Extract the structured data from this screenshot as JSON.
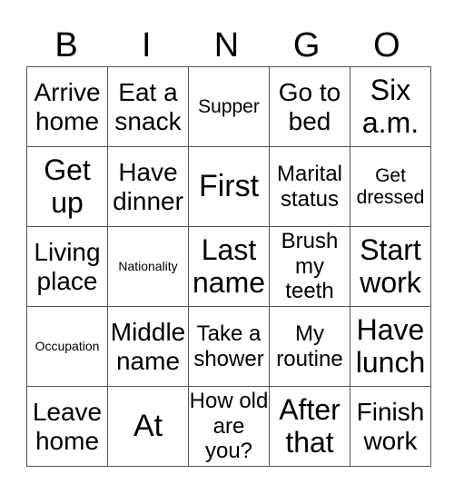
{
  "header": {
    "letters": [
      "B",
      "I",
      "N",
      "G",
      "O"
    ]
  },
  "rows": [
    [
      {
        "text": "Arrive home",
        "size": "s26"
      },
      {
        "text": "Eat a snack",
        "size": "s26"
      },
      {
        "text": "Supper",
        "size": "s18"
      },
      {
        "text": "Go to bed",
        "size": "s26"
      },
      {
        "text": "Six a.m.",
        "size": "s30"
      }
    ],
    [
      {
        "text": "Get up",
        "size": "s30"
      },
      {
        "text": "Have dinner",
        "size": "s26"
      },
      {
        "text": "First",
        "size": "s35"
      },
      {
        "text": "Marital status",
        "size": "s22"
      },
      {
        "text": "Get dressed",
        "size": "s18"
      }
    ],
    [
      {
        "text": "Living place",
        "size": "s26"
      },
      {
        "text": "Nationality",
        "size": "s9"
      },
      {
        "text": "Last name",
        "size": "s30"
      },
      {
        "text": "Brush my teeth",
        "size": "s22"
      },
      {
        "text": "Start work",
        "size": "s30"
      }
    ],
    [
      {
        "text": "Occupation",
        "size": "s9"
      },
      {
        "text": "Middle name",
        "size": "s26"
      },
      {
        "text": "Take a shower",
        "size": "s22"
      },
      {
        "text": "My routine",
        "size": "s22"
      },
      {
        "text": "Have lunch",
        "size": "s30"
      }
    ],
    [
      {
        "text": "Leave home",
        "size": "s26"
      },
      {
        "text": "At",
        "size": "s35"
      },
      {
        "text": "How old are you?",
        "size": "s22"
      },
      {
        "text": "After that",
        "size": "s30"
      },
      {
        "text": "Finish work",
        "size": "s26"
      }
    ]
  ]
}
